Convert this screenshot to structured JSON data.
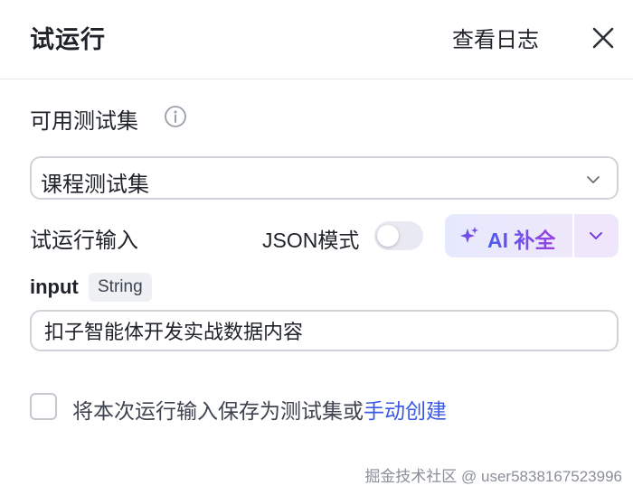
{
  "header": {
    "title": "试运行",
    "view_log_label": "查看日志"
  },
  "test_set": {
    "label": "可用测试集",
    "selected": "课程测试集"
  },
  "run_input": {
    "label": "试运行输入",
    "json_mode_label": "JSON模式",
    "json_mode_on": false,
    "ai_complete_label": "AI 补全"
  },
  "field": {
    "name": "input",
    "type": "String",
    "value": "扣子智能体开发实战数据内容"
  },
  "save": {
    "text": "将本次运行输入保存为测试集或",
    "link": "手动创建",
    "checked": false
  },
  "watermark": "掘金技术社区 @ user5838167523996",
  "colors": {
    "link": "#3a58e6",
    "ai_gradient_start": "#4b5cf0",
    "ai_gradient_end": "#9b3fe0"
  }
}
